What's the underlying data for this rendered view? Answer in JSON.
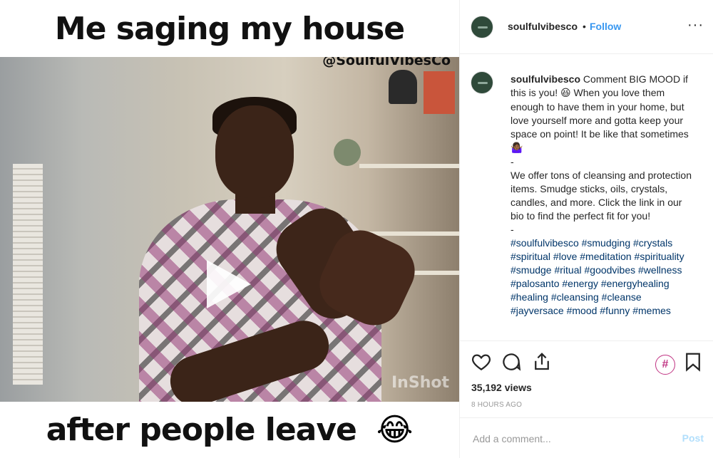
{
  "media": {
    "caption_top": "Me saging my house",
    "watermark": "@SoulfulVibesCo",
    "app_watermark": "InShot",
    "caption_bottom": "after people leave",
    "caption_bottom_emoji": "😂",
    "play_icon": "play-icon"
  },
  "header": {
    "username": "soulfulvibesco",
    "separator": "•",
    "follow_label": "Follow",
    "more_label": "···"
  },
  "caption": {
    "username": "soulfulvibesco",
    "line1": "Comment BIG MOOD if this is you! ",
    "emoji1": "😆",
    "line2": " When you love them enough to have them in your home, but love yourself more and gotta keep your space on point! It be like that sometimes ",
    "emoji2": "🤷🏾‍♀️",
    "dash1": "-",
    "body": "We offer tons of cleansing and protection items. Smudge sticks, oils, crystals, candles, and more. Click the link in our bio to find the perfect fit for you!",
    "dash2": "-",
    "hashtags": "#soulfulvibesco #smudging #crystals #spiritual #love #meditation #spirituality #smudge #ritual #goodvibes #wellness #palosanto #energy #energyhealing #healing #cleansing #cleanse #jayversace #mood #funny #memes"
  },
  "actions": {
    "heart_icon": "heart-icon",
    "comment_icon": "comment-icon",
    "share_icon": "share-icon",
    "hashtag_label": "#",
    "save_icon": "bookmark-icon",
    "views": "35,192 views",
    "time": "8 HOURS AGO"
  },
  "add_comment": {
    "placeholder": "Add a comment...",
    "post_label": "Post"
  },
  "colors": {
    "link": "#3897f0",
    "hashtag": "#003569",
    "post_disabled": "#b2dffc",
    "hashtag_button": "#c13584"
  }
}
